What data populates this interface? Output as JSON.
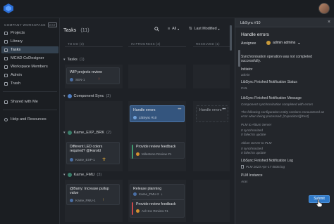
{
  "sidebar": {
    "workspace_label": "COMPANY WORKSPACE",
    "workspace_badge": "EST",
    "items": [
      {
        "label": "Projects"
      },
      {
        "label": "Library"
      },
      {
        "label": "Tasks"
      },
      {
        "label": "MCAD CoDesigner"
      },
      {
        "label": "Workspace Members"
      },
      {
        "label": "Admin"
      },
      {
        "label": "Trash"
      }
    ],
    "footer_items": [
      {
        "label": "Shared with Me"
      },
      {
        "label": "Help and Resources"
      }
    ]
  },
  "header": {
    "title": "Tasks",
    "count": "(11)",
    "filter_label": "All",
    "sort_label": "Last Modified"
  },
  "columns": [
    "TO DO",
    "IN PROGRESS",
    "RESOLVED"
  ],
  "column_counts": [
    "(3)",
    "(4)",
    "(1)"
  ],
  "groups": [
    {
      "name": "Tasks",
      "count": "(1)",
      "cards": [
        {
          "title": "WIP projects review",
          "meta": "SEN-1"
        }
      ]
    },
    {
      "name": "Component Sync",
      "count": "(2)",
      "cards": [
        {
          "title": "Handle errors",
          "meta": "LibSync #10"
        },
        {
          "title": "Handle errors"
        }
      ]
    },
    {
      "name": "Kame_EXP_BRK",
      "count": "(2)",
      "cards": [
        {
          "title": "Different LED colors required? @Harold",
          "meta": "Kame_EXP-1"
        },
        {
          "title": "Provide review feedback",
          "meta": "Milestone Review #1"
        }
      ]
    },
    {
      "name": "Kame_FMU",
      "count": "(3)",
      "cards": [
        {
          "title": "@Barry: Increase pullup value",
          "meta": "Kame_FMU-1"
        },
        {
          "title": "Release planning",
          "meta": "Kame_FMU-2"
        },
        {
          "title": "Provide review feedback",
          "meta": "Ad Hoc Review #1"
        }
      ]
    }
  ],
  "panel": {
    "id": "LibSync #10",
    "title": "Handle errors",
    "assignee_label": "Assignee",
    "assignee_value": "admin admins",
    "status_text": "Synchronisation operation was not completed successfully.",
    "initiator_label": "Initiator",
    "initiator_value": "admin",
    "ls_status_label": "LibSync Finished Notification Status",
    "ls_status_value": "FAIL",
    "ls_message_label": "LibSync Finished Notification Message",
    "ls_message_value": "Component synchronization completed with errors",
    "ls_detail": "The following configuration entity sections encountered an error when being processed: [Capacitors][Rest]",
    "plm_line": "PLM to Altium Server",
    "counts_1": [
      "0 synchronized",
      "0 failed to update"
    ],
    "altium_line": "Altium Server to PLM",
    "counts_2": [
      "0 synchronized",
      "0 failed to update"
    ],
    "log_label": "LibSync Finished Notification Log",
    "log_file": "PLM 2023-Apr-17 0836.log",
    "plm_instance_label": "PLM Instance",
    "plm_instance_value": "Aras",
    "submit_label": "Submit"
  },
  "colors": {
    "accent": "#2f79c8",
    "selected_card": "#34557e",
    "background": "#1e2126"
  }
}
